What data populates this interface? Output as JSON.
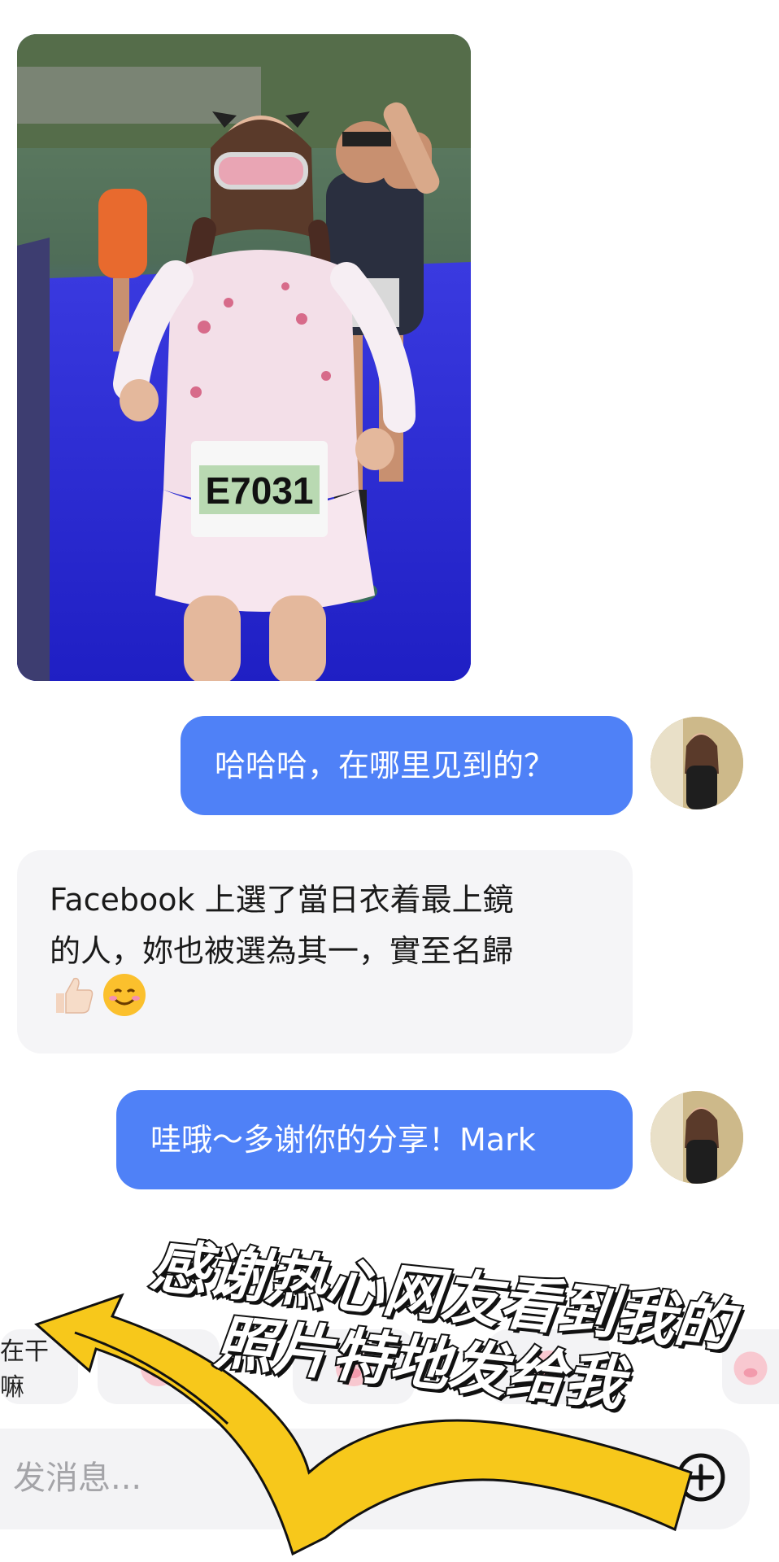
{
  "messages": [
    {
      "direction": "outgoing",
      "text": "哈哈哈，在哪里见到的？"
    },
    {
      "direction": "incoming",
      "text_line1": "Facebook 上選了當日衣着最上鏡",
      "text_line2": "的人，妳也被選為其一，實至名歸",
      "emojis": [
        "thumbs-up",
        "smiling-face"
      ]
    },
    {
      "direction": "outgoing",
      "text": "哇哦～多谢你的分享！Mark"
    }
  ],
  "photo": {
    "bib_number": "E7031"
  },
  "quick_replies": {
    "first_chip_label": "在干嘛"
  },
  "input": {
    "placeholder": "发消息..."
  },
  "caption": {
    "line1": "感谢热心网友看到我的",
    "line2": "照片特地发给我"
  },
  "colors": {
    "outgoing_bubble": "#4f81f7",
    "incoming_bubble": "#f5f5f7",
    "arrow": "#f7c81b"
  }
}
